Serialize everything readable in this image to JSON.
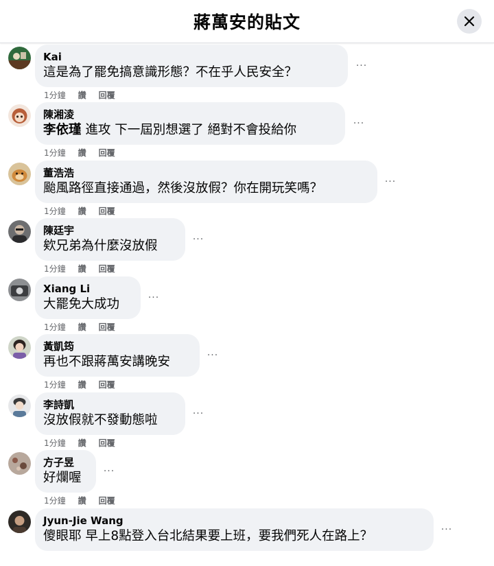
{
  "header": {
    "title": "蔣萬安的貼文"
  },
  "comments": [
    {
      "author": "Kai",
      "text": "這是為了罷免搞意識形態？不在乎人民安全？",
      "time": "1分鐘",
      "like": "讚",
      "reply": "回覆",
      "more": "···"
    },
    {
      "author": "陳湘淩",
      "mention": "李依瑾",
      "text": " 進攻 下一屆別想選了 絕對不會投給你",
      "time": "1分鐘",
      "like": "讚",
      "reply": "回覆",
      "more": "···"
    },
    {
      "author": "董浩浩",
      "text": "颱風路徑直接通過，然後沒放假？你在開玩笑嗎？",
      "time": "1分鐘",
      "like": "讚",
      "reply": "回覆",
      "more": "···"
    },
    {
      "author": "陳廷宇",
      "text": "欸兄弟為什麼沒放假",
      "time": "1分鐘",
      "like": "讚",
      "reply": "回覆",
      "more": "···"
    },
    {
      "author": "Xiang Li",
      "text": "大罷免大成功",
      "time": "1分鐘",
      "like": "讚",
      "reply": "回覆",
      "more": "···"
    },
    {
      "author": "黃凱筠",
      "text": "再也不跟蔣萬安講晚安",
      "time": "1分鐘",
      "like": "讚",
      "reply": "回覆",
      "more": "···"
    },
    {
      "author": "李詩凱",
      "text": "沒放假就不發動態啦",
      "time": "1分鐘",
      "like": "讚",
      "reply": "回覆",
      "more": "···"
    },
    {
      "author": "方子昱",
      "text": "好爛喔",
      "time": "1分鐘",
      "like": "讚",
      "reply": "回覆",
      "more": "···"
    },
    {
      "author": "Jyun-Jie Wang",
      "text": "傻眼耶 早上8點登入台北結果要上班，要我們死人在路上？",
      "time": "",
      "like": "",
      "reply": "",
      "more": "···"
    }
  ],
  "colors": {
    "bubble": "#f0f2f5",
    "secondary_text": "#65676b",
    "close_button_bg": "#e4e6eb"
  },
  "icons": {
    "close": "close-icon",
    "more": "more-dots-icon"
  }
}
